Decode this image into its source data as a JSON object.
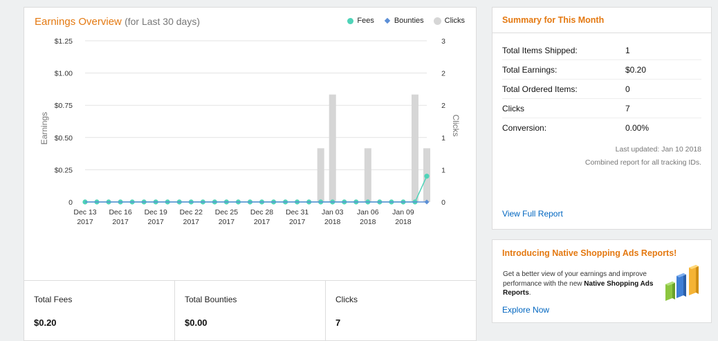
{
  "chart_card": {
    "title": "Earnings Overview",
    "subtitle": "(for Last 30 days)",
    "legend": [
      {
        "label": "Fees",
        "color": "#4fd3b8",
        "shape": "circle"
      },
      {
        "label": "Bounties",
        "color": "#5c8fd6",
        "shape": "diamond"
      },
      {
        "label": "Clicks",
        "color": "#cfcfcf",
        "shape": "circle"
      }
    ],
    "totals": [
      {
        "label": "Total Fees",
        "value": "$0.20"
      },
      {
        "label": "Total Bounties",
        "value": "$0.00"
      },
      {
        "label": "Clicks",
        "value": "7"
      }
    ]
  },
  "chart_data": {
    "type": "line",
    "title": "",
    "xlabel": "",
    "ylabel": "Earnings",
    "y2label": "Clicks",
    "ylim": [
      0,
      1.25
    ],
    "y2lim": [
      0,
      3
    ],
    "y_ticks": [
      "$1.25",
      "$1.00",
      "$0.75",
      "$0.50",
      "$0.25",
      "0"
    ],
    "y_tick_values": [
      1.25,
      1.0,
      0.75,
      0.5,
      0.25,
      0
    ],
    "y2_ticks": [
      "3",
      "2",
      "2",
      "1",
      "1",
      "0"
    ],
    "x_tick_labels": [
      [
        "Dec 13",
        "2017"
      ],
      [
        "Dec 16",
        "2017"
      ],
      [
        "Dec 19",
        "2017"
      ],
      [
        "Dec 22",
        "2017"
      ],
      [
        "Dec 25",
        "2017"
      ],
      [
        "Dec 28",
        "2017"
      ],
      [
        "Dec 31",
        "2017"
      ],
      [
        "Jan 03",
        "2018"
      ],
      [
        "Jan 06",
        "2018"
      ],
      [
        "Jan 09",
        "2018"
      ]
    ],
    "x_tick_dates": [
      "2017-12-13",
      "2017-12-16",
      "2017-12-19",
      "2017-12-22",
      "2017-12-25",
      "2017-12-28",
      "2017-12-31",
      "2018-01-03",
      "2018-01-06",
      "2018-01-09"
    ],
    "x": [
      "2017-12-13",
      "2017-12-14",
      "2017-12-15",
      "2017-12-16",
      "2017-12-17",
      "2017-12-18",
      "2017-12-19",
      "2017-12-20",
      "2017-12-21",
      "2017-12-22",
      "2017-12-23",
      "2017-12-24",
      "2017-12-25",
      "2017-12-26",
      "2017-12-27",
      "2017-12-28",
      "2017-12-29",
      "2017-12-30",
      "2017-12-31",
      "2018-01-01",
      "2018-01-02",
      "2018-01-03",
      "2018-01-04",
      "2018-01-05",
      "2018-01-06",
      "2018-01-07",
      "2018-01-08",
      "2018-01-09",
      "2018-01-10",
      "2018-01-11"
    ],
    "series": [
      {
        "name": "Fees",
        "axis": "left",
        "kind": "line",
        "color": "#4fd3b8",
        "values": [
          0,
          0,
          0,
          0,
          0,
          0,
          0,
          0,
          0,
          0,
          0,
          0,
          0,
          0,
          0,
          0,
          0,
          0,
          0,
          0,
          0,
          0,
          0,
          0,
          0,
          0,
          0,
          0,
          0,
          0.2
        ]
      },
      {
        "name": "Bounties",
        "axis": "left",
        "kind": "line",
        "color": "#5c8fd6",
        "values": [
          0,
          0,
          0,
          0,
          0,
          0,
          0,
          0,
          0,
          0,
          0,
          0,
          0,
          0,
          0,
          0,
          0,
          0,
          0,
          0,
          0,
          0,
          0,
          0,
          0,
          0,
          0,
          0,
          0,
          0
        ]
      },
      {
        "name": "Clicks",
        "axis": "right",
        "kind": "bar",
        "color": "#d6d6d6",
        "values": [
          0,
          0,
          0,
          0,
          0,
          0,
          0,
          0,
          0,
          0,
          0,
          0,
          0,
          0,
          0,
          0,
          0,
          0,
          0,
          0,
          1,
          2,
          0,
          0,
          1,
          0,
          0,
          0,
          2,
          1
        ]
      }
    ],
    "grid": true,
    "legend_position": "top-right"
  },
  "summary": {
    "title": "Summary for This Month",
    "rows": [
      {
        "label": "Total Items Shipped:",
        "value": "1"
      },
      {
        "label": "Total Earnings:",
        "value": "$0.20"
      },
      {
        "label": "Total Ordered Items:",
        "value": "0"
      },
      {
        "label": "Clicks",
        "value": "7"
      },
      {
        "label": "Conversion:",
        "value": "0.00%"
      }
    ],
    "last_updated": "Last updated: Jan 10 2018",
    "combined_note": "Combined report for all tracking IDs.",
    "view_full_report": "View Full Report"
  },
  "native_ads": {
    "title": "Introducing Native Shopping Ads Reports!",
    "text_before": "Get a better view of your earnings and improve performance with the new ",
    "text_bold": "Native Shopping Ads Reports",
    "text_after": ".",
    "explore_link": "Explore Now",
    "icon": "bar-chart-icon"
  }
}
